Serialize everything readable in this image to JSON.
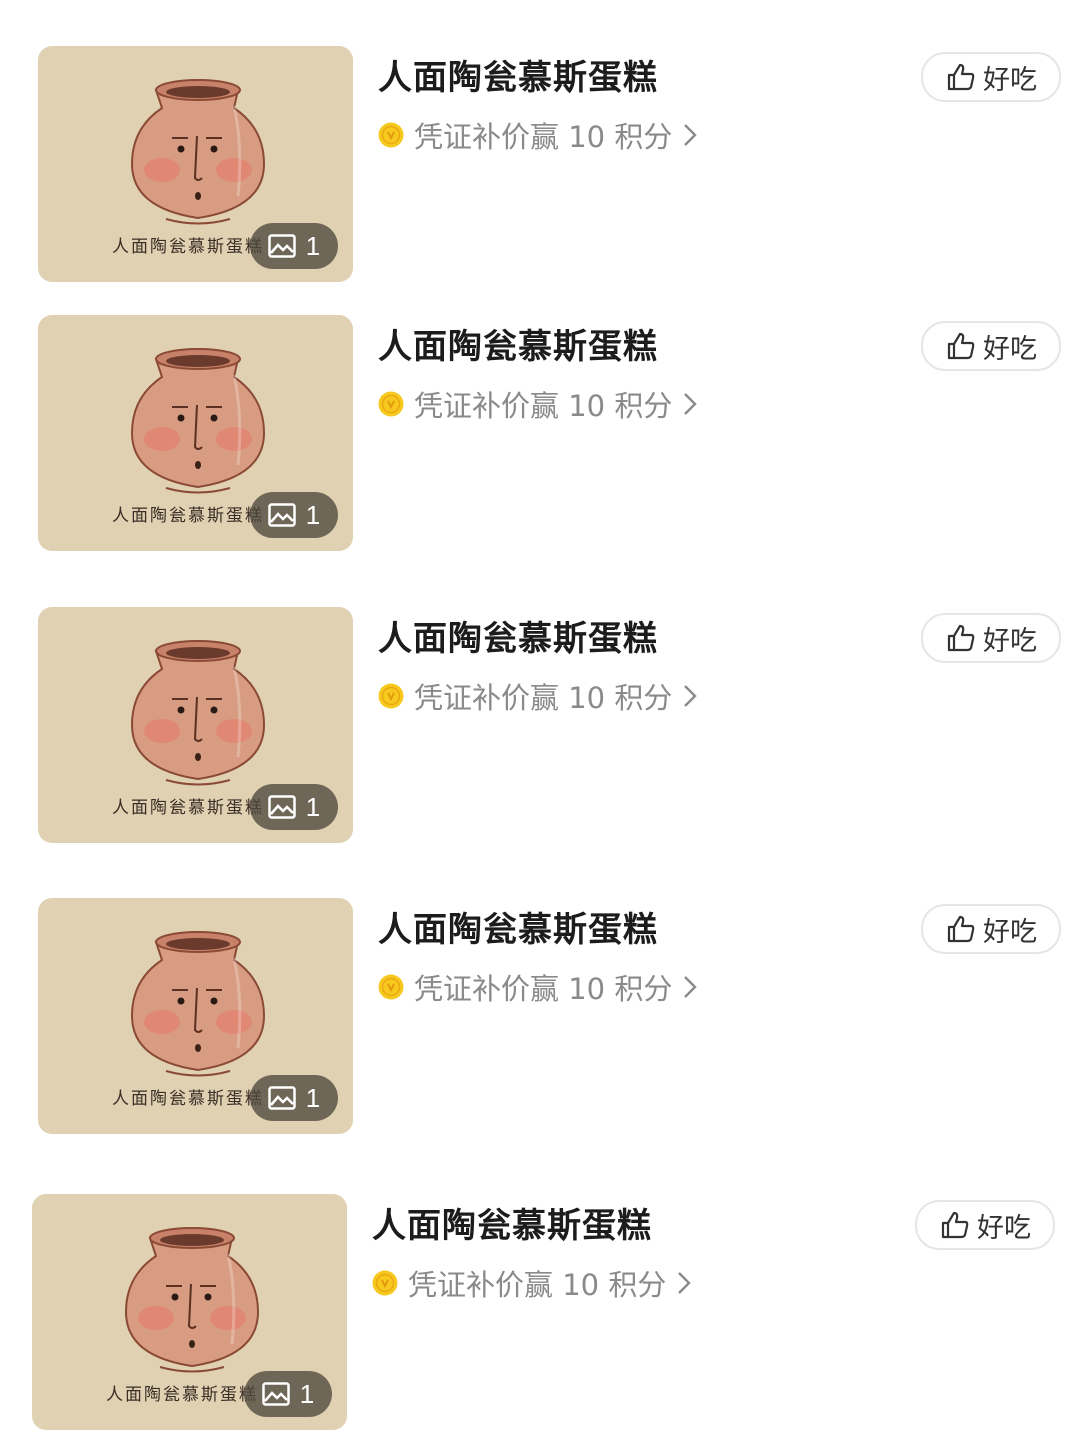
{
  "colors": {
    "thumbnail_bg": "#e0d1b2",
    "pot": "#d89c82",
    "coin": "#f7c91e",
    "secondary_text": "#8a8a8a"
  },
  "items": [
    {
      "name": "人面陶瓮慕斯蛋糕",
      "reward_text": "凭证补价赢 10 积分",
      "like_label": "好吃",
      "photo_count": "1",
      "image_caption": "人面陶瓮慕斯蛋糕",
      "icons": [
        "photo-icon",
        "coin-icon",
        "chevron-right-icon",
        "thumbs-up-icon"
      ]
    },
    {
      "name": "人面陶瓮慕斯蛋糕",
      "reward_text": "凭证补价赢 10 积分",
      "like_label": "好吃",
      "photo_count": "1",
      "image_caption": "人面陶瓮慕斯蛋糕",
      "icons": [
        "photo-icon",
        "coin-icon",
        "chevron-right-icon",
        "thumbs-up-icon"
      ]
    },
    {
      "name": "人面陶瓮慕斯蛋糕",
      "reward_text": "凭证补价赢 10 积分",
      "like_label": "好吃",
      "photo_count": "1",
      "image_caption": "人面陶瓮慕斯蛋糕",
      "icons": [
        "photo-icon",
        "coin-icon",
        "chevron-right-icon",
        "thumbs-up-icon"
      ]
    },
    {
      "name": "人面陶瓮慕斯蛋糕",
      "reward_text": "凭证补价赢 10 积分",
      "like_label": "好吃",
      "photo_count": "1",
      "image_caption": "人面陶瓮慕斯蛋糕",
      "icons": [
        "photo-icon",
        "coin-icon",
        "chevron-right-icon",
        "thumbs-up-icon"
      ]
    },
    {
      "name": "人面陶瓮慕斯蛋糕",
      "reward_text": "凭证补价赢 10 积分",
      "like_label": "好吃",
      "photo_count": "1",
      "image_caption": "人面陶瓮慕斯蛋糕",
      "icons": [
        "photo-icon",
        "coin-icon",
        "chevron-right-icon",
        "thumbs-up-icon"
      ]
    }
  ]
}
